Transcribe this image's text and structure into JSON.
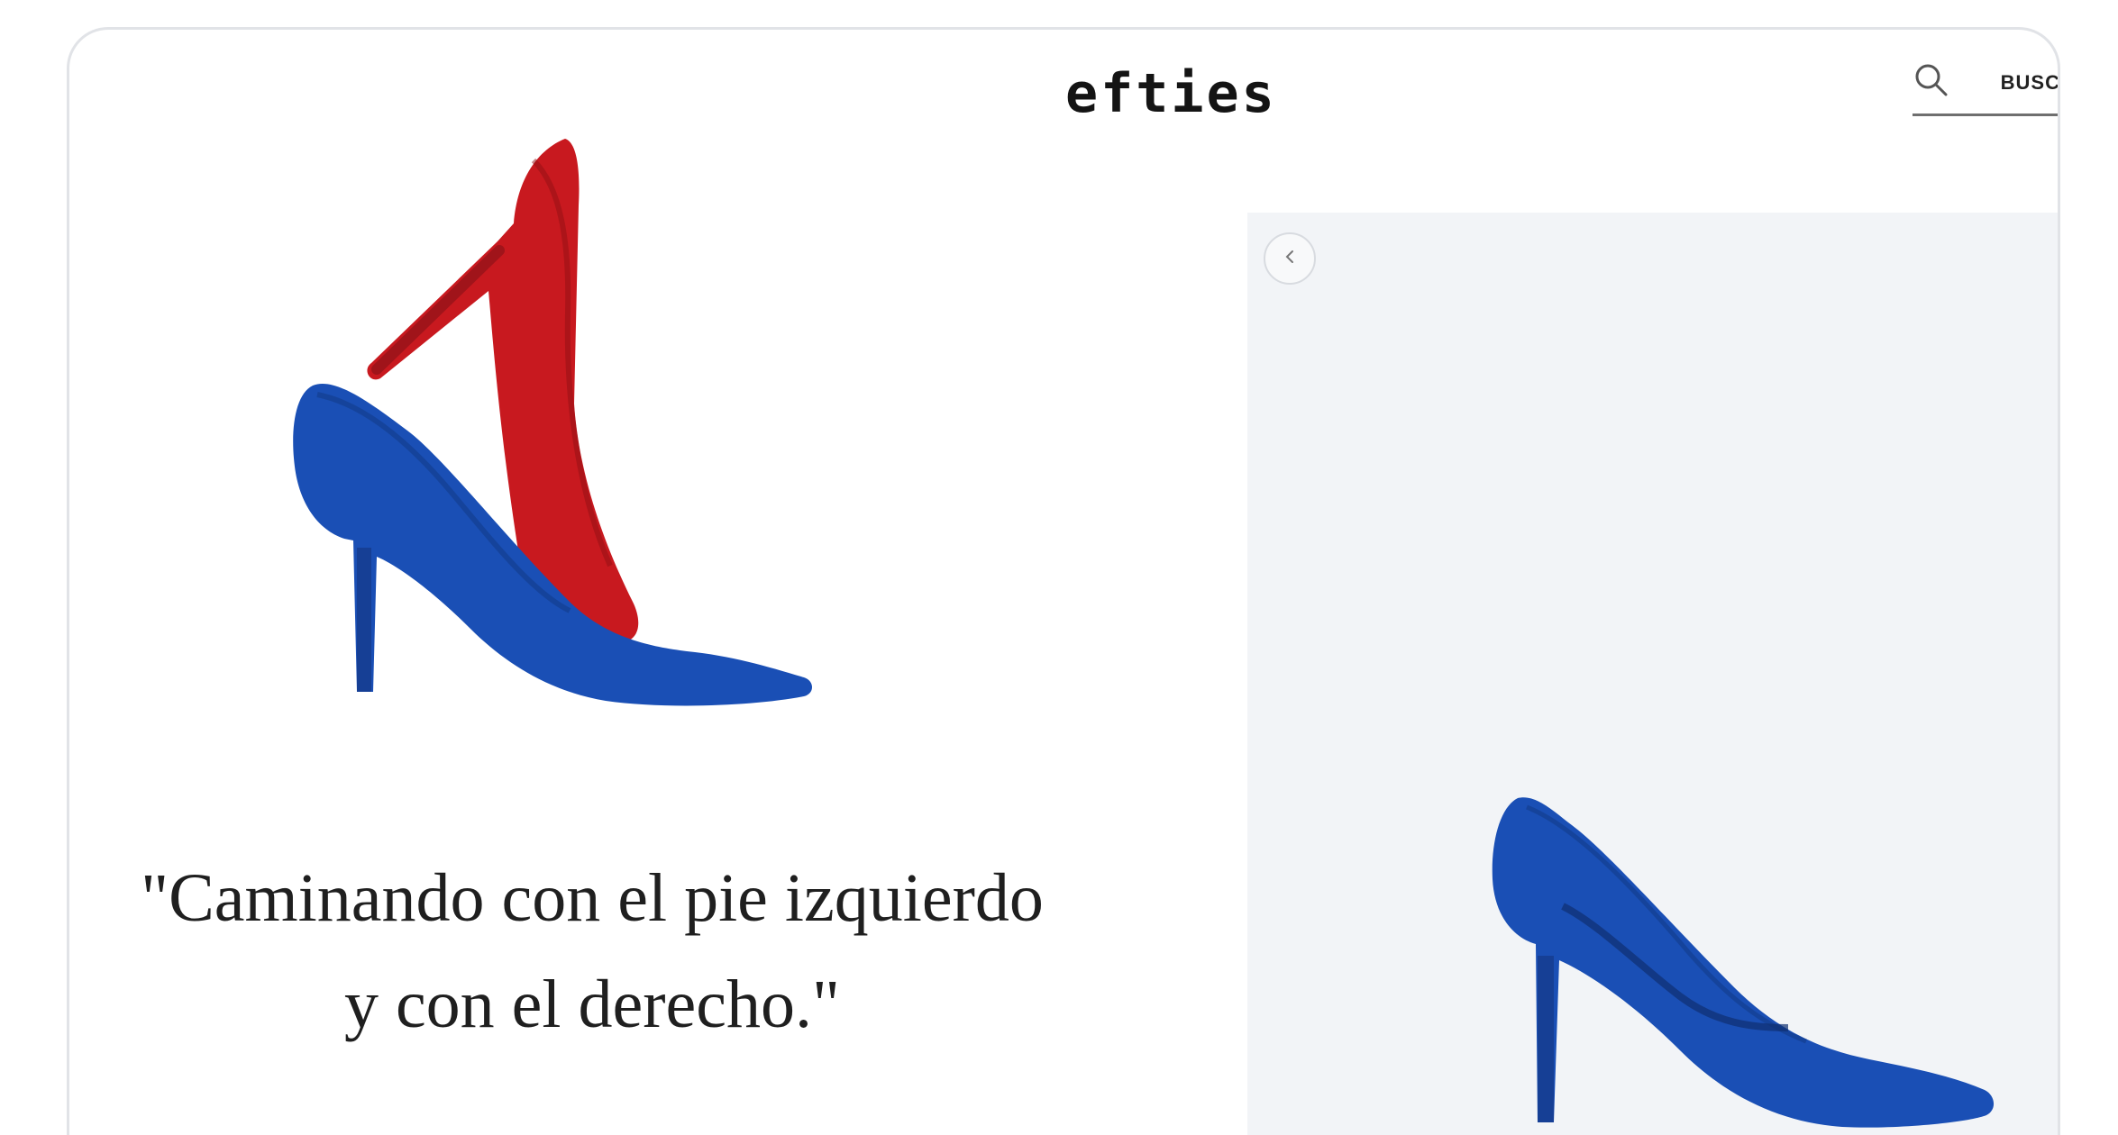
{
  "header": {
    "logo": "efties",
    "search_label": "BUSC"
  },
  "promo": {
    "quote_line1": "\"Caminando con el pie izquierdo",
    "quote_line2": "y con el derecho.\""
  },
  "product": {
    "prev_label": "‹"
  },
  "colors": {
    "blue_shoe": "#1a4fb5",
    "red_shoe": "#c8191f",
    "panel_bg": "#f2f4f7"
  },
  "icons": [
    "search-icon",
    "chevron-left-icon"
  ]
}
